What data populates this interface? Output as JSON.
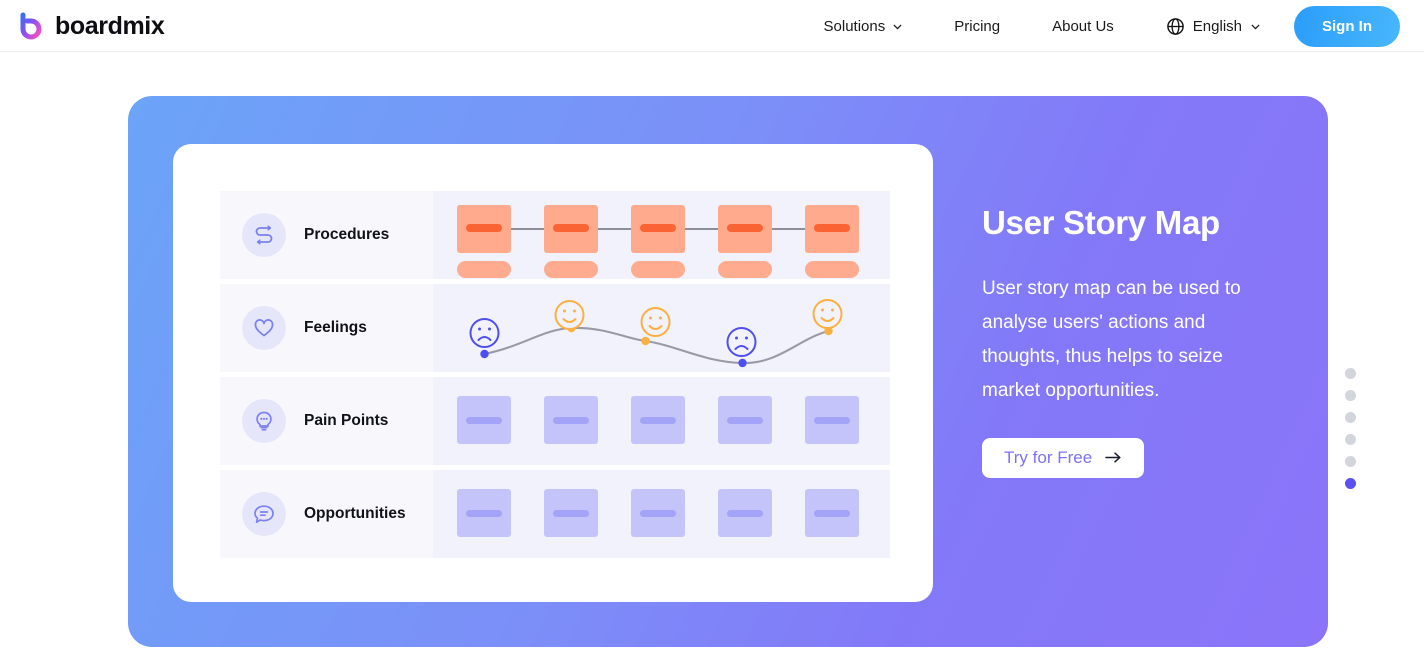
{
  "brand": {
    "name": "boardmix",
    "logo_icon": "boardmix-b-logo"
  },
  "nav": {
    "items": [
      {
        "label": "Solutions",
        "has_chevron": true,
        "icon": "chevron-down-icon"
      },
      {
        "label": "Pricing",
        "has_chevron": false
      },
      {
        "label": "About Us",
        "has_chevron": false
      }
    ],
    "language": {
      "label": "English",
      "icon": "globe-icon",
      "chevron": "chevron-down-icon"
    },
    "sign_in": "Sign In"
  },
  "hero": {
    "gradient_from": "#6ba4f8",
    "gradient_to": "#8b74f9",
    "title": "User Story Map",
    "description": "User story map can be used to analyse users' actions and thoughts, thus helps to seize market opportunities.",
    "cta": {
      "label": "Try for Free",
      "arrow": "arrow-right-icon"
    }
  },
  "board": {
    "rows": [
      {
        "label": "Procedures",
        "icon": "process-flow-icon",
        "type": "procedures"
      },
      {
        "label": "Feelings",
        "icon": "heart-icon",
        "type": "feelings"
      },
      {
        "label": "Pain Points",
        "icon": "lightbulb-icon",
        "type": "cards"
      },
      {
        "label": "Opportunities",
        "icon": "speech-bubble-icon",
        "type": "cards"
      }
    ],
    "procedures": {
      "card_count": 5,
      "card_color": "#ffaa8d",
      "bar_color": "#fa6434",
      "pill_color": "#ffab90",
      "connector_color": "#8d8d9c"
    },
    "feelings": {
      "points": [
        {
          "mood": "sad",
          "color": "#4f4ff0"
        },
        {
          "mood": "happy",
          "color": "#fbb03f"
        },
        {
          "mood": "happy",
          "color": "#fbb03f"
        },
        {
          "mood": "sad",
          "color": "#4f4ff0"
        },
        {
          "mood": "happy",
          "color": "#fbb03f"
        }
      ],
      "curve_color": "#9a9aa4"
    },
    "cards": {
      "count": 5,
      "card_color": "#c4c4fb",
      "bar_color": "#a3a3f7"
    }
  },
  "pagination": {
    "total": 6,
    "active_index": 5,
    "active_color": "#5b51f0",
    "inactive_color": "#d3d5dc"
  }
}
